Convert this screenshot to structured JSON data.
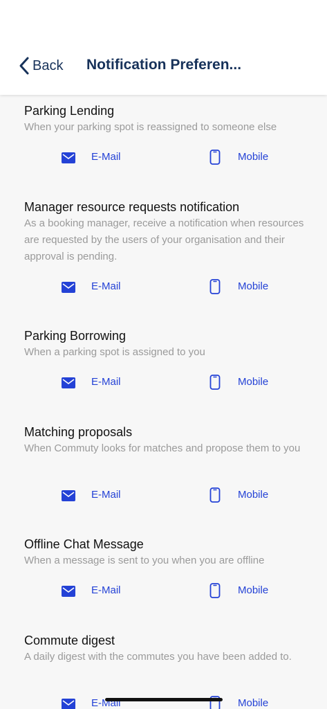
{
  "header": {
    "back_label": "Back",
    "title": "Notification Preferen..."
  },
  "colors": {
    "accent": "#2442d6",
    "header_text": "#17325a",
    "description": "#9a9a9a"
  },
  "channel_labels": {
    "email": "E-Mail",
    "mobile": "Mobile"
  },
  "sections": [
    {
      "title": "Parking Lending",
      "description": "When your parking spot is reassigned to someone else"
    },
    {
      "title": "Manager resource requests notification",
      "description": "As a booking manager, receive a notification when resources are requested by the users of your organisation and their approval is pending."
    },
    {
      "title": "Parking Borrowing",
      "description": "When a parking spot is assigned to you"
    },
    {
      "title": "Matching proposals",
      "description": "When Commuty looks for matches and propose them to you"
    },
    {
      "title": "Offline Chat Message",
      "description": "When a message is sent to you when you are offline"
    },
    {
      "title": "Commute digest",
      "description": "A daily digest with the commutes you have been added to."
    }
  ]
}
